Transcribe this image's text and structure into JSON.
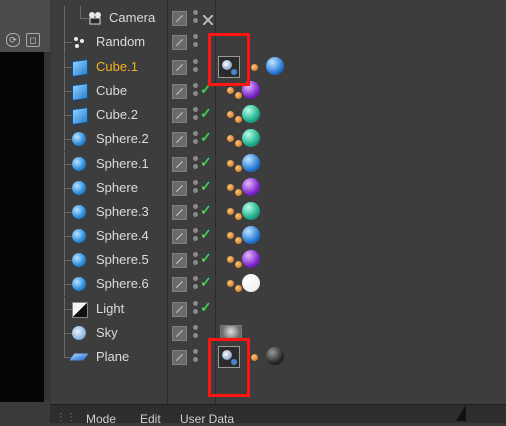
{
  "objects": [
    {
      "name": "Camera",
      "icon": "camera-icon",
      "checked": false
    },
    {
      "name": "Random",
      "icon": "random-effector-icon",
      "checked": false
    },
    {
      "name": "Cube.1",
      "icon": "cube-icon",
      "selected": true,
      "checked": false
    },
    {
      "name": "Cube",
      "icon": "cube-icon",
      "checked": true
    },
    {
      "name": "Cube.2",
      "icon": "cube-icon",
      "checked": true
    },
    {
      "name": "Sphere.2",
      "icon": "sphere-icon",
      "checked": true
    },
    {
      "name": "Sphere.1",
      "icon": "sphere-icon",
      "checked": true
    },
    {
      "name": "Sphere",
      "icon": "sphere-icon",
      "checked": true
    },
    {
      "name": "Sphere.3",
      "icon": "sphere-icon",
      "checked": true
    },
    {
      "name": "Sphere.4",
      "icon": "sphere-icon",
      "checked": true
    },
    {
      "name": "Sphere.5",
      "icon": "sphere-icon",
      "checked": true
    },
    {
      "name": "Sphere.6",
      "icon": "sphere-icon",
      "checked": true
    },
    {
      "name": "Light",
      "icon": "light-icon",
      "checked": true
    },
    {
      "name": "Sky",
      "icon": "sky-icon",
      "checked": false
    },
    {
      "name": "Plane",
      "icon": "plane-icon",
      "checked": false
    }
  ],
  "bottom_menu": {
    "mode": "Mode",
    "edit": "Edit",
    "user_data": "User Data"
  },
  "colors": {
    "selected_text": "#f5b21b",
    "highlight_box": "#ff1414",
    "check": "#3fd14e"
  }
}
